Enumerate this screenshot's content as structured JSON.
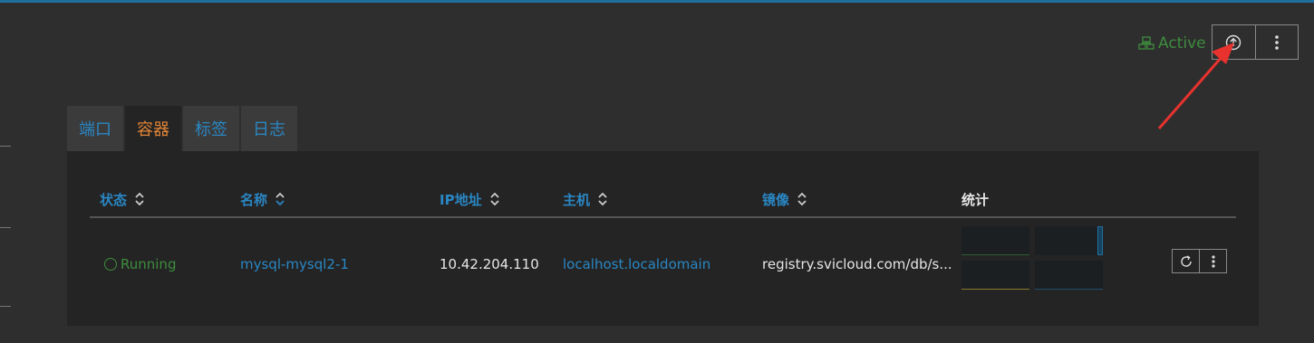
{
  "header": {
    "status_label": "Active",
    "status_color": "#3e8c3e",
    "actions": [
      {
        "icon": "upgrade-arrow-up-circle-icon"
      },
      {
        "icon": "more-vertical-icon"
      }
    ]
  },
  "tabs": [
    {
      "label": "端口",
      "active": false
    },
    {
      "label": "容器",
      "active": true
    },
    {
      "label": "标签",
      "active": false
    },
    {
      "label": "日志",
      "active": false
    }
  ],
  "table": {
    "columns": [
      "状态",
      "名称",
      "IP地址",
      "主机",
      "镜像",
      "统计"
    ],
    "rows": [
      {
        "state": "Running",
        "name": "mysql-mysql2-1",
        "ip": "10.42.204.110",
        "host": "localhost.localdomain",
        "image": "registry.svicloud.com/db/s..."
      }
    ]
  },
  "colors": {
    "accent": "#2a87c4",
    "active_tab": "#e38536",
    "running": "#3e8c3e",
    "annotation_arrow": "#e8322e"
  }
}
